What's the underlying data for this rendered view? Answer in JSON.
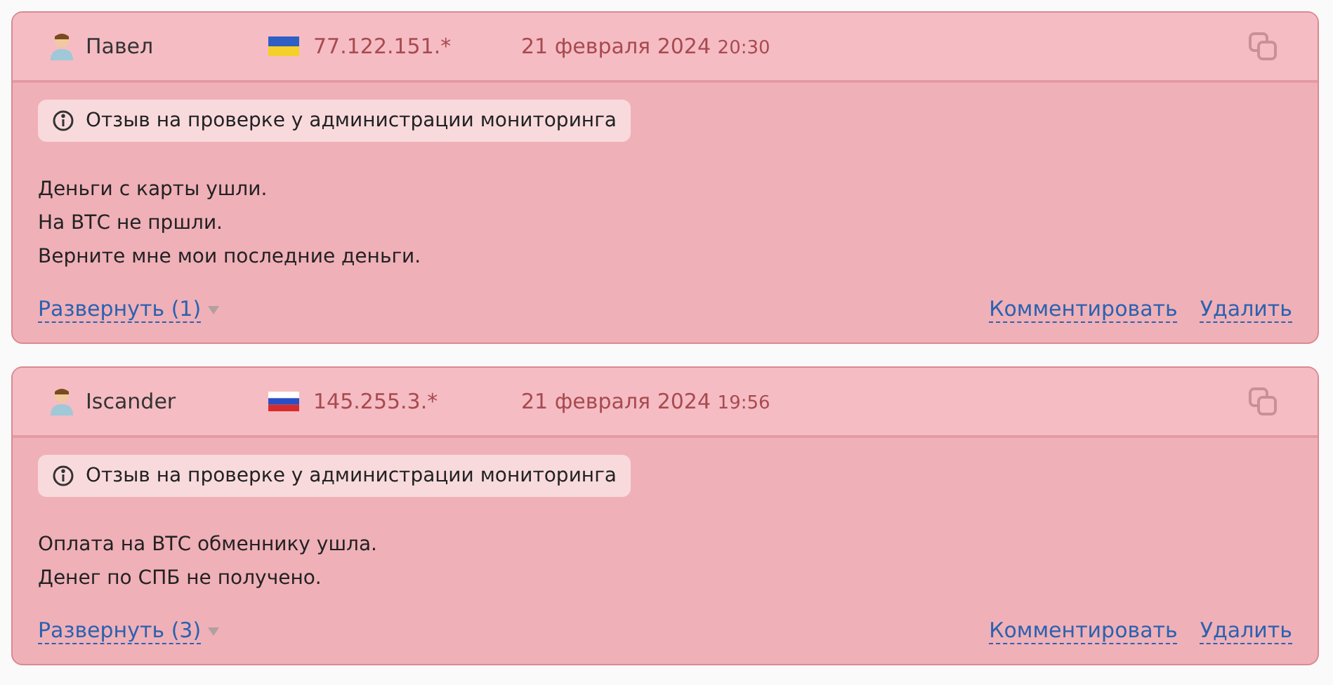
{
  "reviews": [
    {
      "author": "Павел",
      "kind": "ua",
      "ip": "77.122.151.*",
      "date": "21 февраля 2024",
      "time": "20:30",
      "notice": "Отзыв на проверке у администрации мониторинга",
      "lines": [
        "Деньги с карты ушли.",
        "На ВТС не пршли.",
        "Верните мне мои последние деньги."
      ],
      "expand": "Развернуть (1)",
      "actions": [
        "Комментировать",
        "Удалить"
      ]
    },
    {
      "author": "Iscander",
      "kind": "ru",
      "ip": "145.255.3.*",
      "date": "21 февраля 2024",
      "time": "19:56",
      "notice": "Отзыв на проверке у администрации мониторинга",
      "lines": [
        "Оплата на ВТС обменнику ушла.",
        "Денег по СПБ не получено."
      ],
      "expand": "Развернуть (3)",
      "actions": [
        "Комментировать",
        "Удалить"
      ]
    }
  ]
}
